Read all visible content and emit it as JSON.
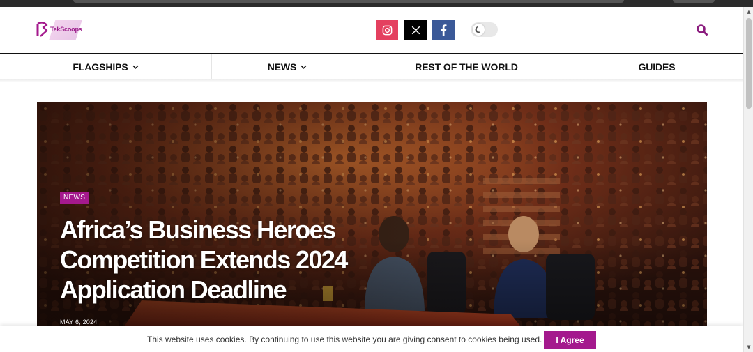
{
  "site": {
    "logo_text": "TekScoops",
    "brand_color": "#a4198d"
  },
  "header": {
    "social": [
      {
        "name": "instagram",
        "icon": "instagram-icon",
        "color": "#e4405f"
      },
      {
        "name": "x",
        "icon": "x-icon",
        "color": "#000000"
      },
      {
        "name": "facebook",
        "icon": "facebook-icon",
        "color": "#3b5998"
      }
    ],
    "theme_toggle_icon": "moon-icon",
    "search_icon": "search-icon"
  },
  "nav": {
    "items": [
      {
        "label": "FLAGSHIPS",
        "has_dropdown": true
      },
      {
        "label": "NEWS",
        "has_dropdown": true
      },
      {
        "label": "REST OF THE WORLD",
        "has_dropdown": false
      },
      {
        "label": "GUIDES",
        "has_dropdown": false
      }
    ]
  },
  "hero": {
    "category": "NEWS",
    "title": "Africa’s Business Heroes Competition Extends 2024 Application Deadline",
    "date": "MAY 6, 2024"
  },
  "cookie": {
    "message": "This website uses cookies. By continuing to use this website you are giving consent to cookies being used.",
    "button_label": "I Agree"
  }
}
